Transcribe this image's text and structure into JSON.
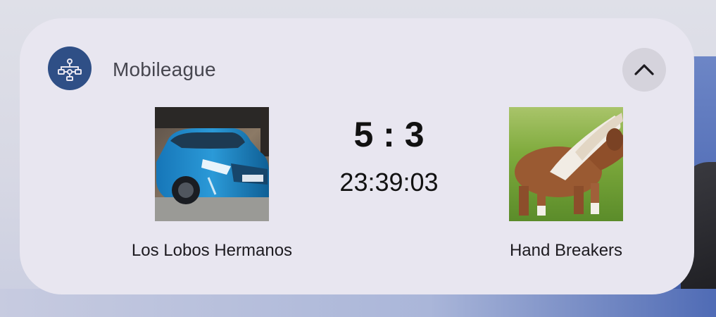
{
  "widget": {
    "app_name": "Mobileague",
    "app_icon": "league-bracket-icon",
    "collapse_icon": "chevron-up-icon",
    "accent_color": "#2f4f86"
  },
  "match": {
    "score": "5 : 3",
    "clock": "23:39:03",
    "home_team": {
      "name": "Los Lobos Hermanos",
      "logo": "blue-car-photo"
    },
    "away_team": {
      "name": "Hand Breakers",
      "logo": "pony-photo"
    }
  }
}
